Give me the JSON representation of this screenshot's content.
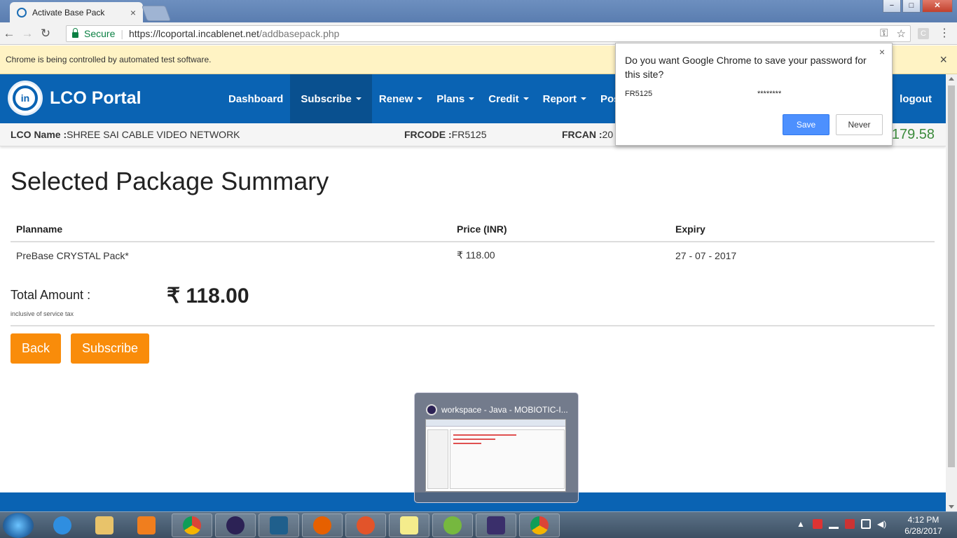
{
  "browser": {
    "tab_title": "Activate Base Pack",
    "tab_close": "×",
    "secure_label": "Secure",
    "url_host": "https://lcoportal.incablenet.net",
    "url_path": "/addbasepack.php",
    "ext_label": "C",
    "infobar_text": "Chrome is being controlled by automated test software.",
    "infobar_close": "×",
    "window_buttons": {
      "minimize": "−",
      "maximize": "□",
      "close": "✕"
    }
  },
  "site": {
    "brand": "LCO Portal",
    "logo_text": "in",
    "nav": {
      "dashboard": "Dashboard",
      "subscribe": "Subscribe",
      "renew": "Renew",
      "plans": "Plans",
      "credit": "Credit",
      "report": "Report",
      "postpaid": "Postpaid"
    },
    "logout": "logout"
  },
  "strip": {
    "lco_name_label": "LCO Name :",
    "lco_name_value": "SHREE SAI CABLE VIDEO NETWORK",
    "frcode_label": "FRCODE :",
    "frcode_value": "FR5125",
    "frcan_label": "FRCAN :",
    "frcan_value": "20",
    "balance_partial": "179.58"
  },
  "page": {
    "title": "Selected Package Summary",
    "table": {
      "headers": {
        "planname": "Planname",
        "price": "Price (INR)",
        "expiry": "Expiry"
      },
      "rows": [
        {
          "planname": "PreBase CRYSTAL Pack*",
          "price": "₹ 118.00",
          "expiry": "27 - 07 - 2017"
        }
      ]
    },
    "total_label": "Total Amount :",
    "total_note": "inclusive of service tax",
    "total_amount": "₹ 118.00",
    "back_button": "Back",
    "subscribe_button": "Subscribe"
  },
  "password_popup": {
    "question": "Do you want Google Chrome to save your password for this site?",
    "close": "×",
    "username": "FR5125",
    "password_mask": "********",
    "save_label": "Save",
    "never_label": "Never"
  },
  "taskbar": {
    "thumbnail_title": "workspace - Java - MOBIOTIC-I...",
    "time": "4:12 PM",
    "date": "6/28/2017",
    "apps": [
      "internet-explorer",
      "file-explorer",
      "media-player",
      "chrome",
      "eclipse",
      "mysql-workbench",
      "firefox",
      "tool-app",
      "sticky-notes",
      "utorrent",
      "java-ee-ide",
      "chrome"
    ]
  },
  "colors": {
    "header_blue": "#0a63b3",
    "nav_active": "#09508f",
    "button_orange": "#f98c0a",
    "balance_green": "#3c8b3c",
    "save_blue": "#4d90fe",
    "infobar_yellow": "#fff3c4"
  }
}
